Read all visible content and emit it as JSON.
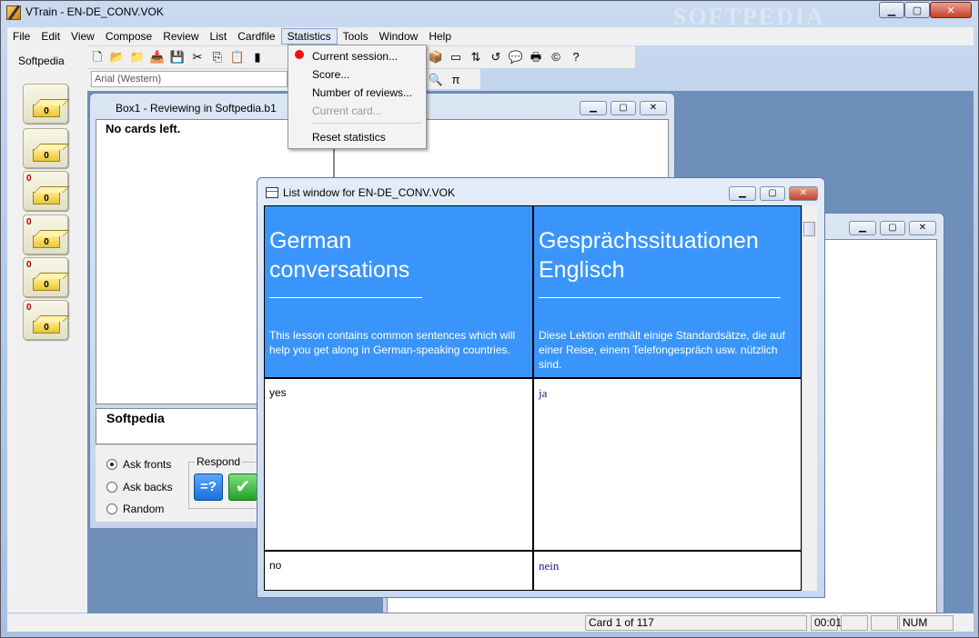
{
  "app": {
    "title": "VTrain - EN-DE_CONV.VOK",
    "watermark": "SOFTPEDIA",
    "min": "▁",
    "max": "▢",
    "close": "✕"
  },
  "menu": [
    "File",
    "Edit",
    "View",
    "Compose",
    "Review",
    "List",
    "Cardfile",
    "Statistics",
    "Tools",
    "Window",
    "Help"
  ],
  "statistics_menu": {
    "current_session": "Current session...",
    "score": "Score...",
    "number_of_reviews": "Number of reviews...",
    "current_card": "Current card...",
    "reset_statistics": "Reset statistics"
  },
  "left": {
    "label": "Softpedia",
    "boxes": [
      {
        "count": "",
        "cards": "0"
      },
      {
        "count": "",
        "cards": "0"
      },
      {
        "count": "0",
        "cards": "0"
      },
      {
        "count": "0",
        "cards": "0"
      },
      {
        "count": "0",
        "cards": "0"
      },
      {
        "count": "0",
        "cards": "0"
      }
    ]
  },
  "font_select": "Arial (Western)",
  "box1": {
    "title": "Box1 - Reviewing in Softpedia.b1",
    "no_cards": "No cards left.",
    "field_text": "Softpedia",
    "radios": {
      "ask_fronts": "Ask fronts",
      "ask_backs": "Ask backs",
      "random": "Random"
    },
    "respond_label": "Respond",
    "ask_button": "=?",
    "ok_button": "✔"
  },
  "listwin": {
    "title": "List window for EN-DE_CONV.VOK",
    "header_left": {
      "title": "German conversations",
      "desc": "This lesson contains common sentences which will help you get along in German-speaking countries."
    },
    "header_right": {
      "title": "Gesprächssituationen Englisch",
      "desc": "Diese Lektion enthält einige Standardsätze, die auf einer Reise, einem Telefongespräch usw. nützlich sind."
    },
    "rows": [
      {
        "front": "yes",
        "back": "ja"
      },
      {
        "front": "no",
        "back": "nein"
      }
    ]
  },
  "status": {
    "card": "Card 1 of 117",
    "time": "00:01",
    "num": "NUM"
  },
  "colors": {
    "header_blue": "#3a95fb",
    "desktop": "#6e8fb9"
  }
}
